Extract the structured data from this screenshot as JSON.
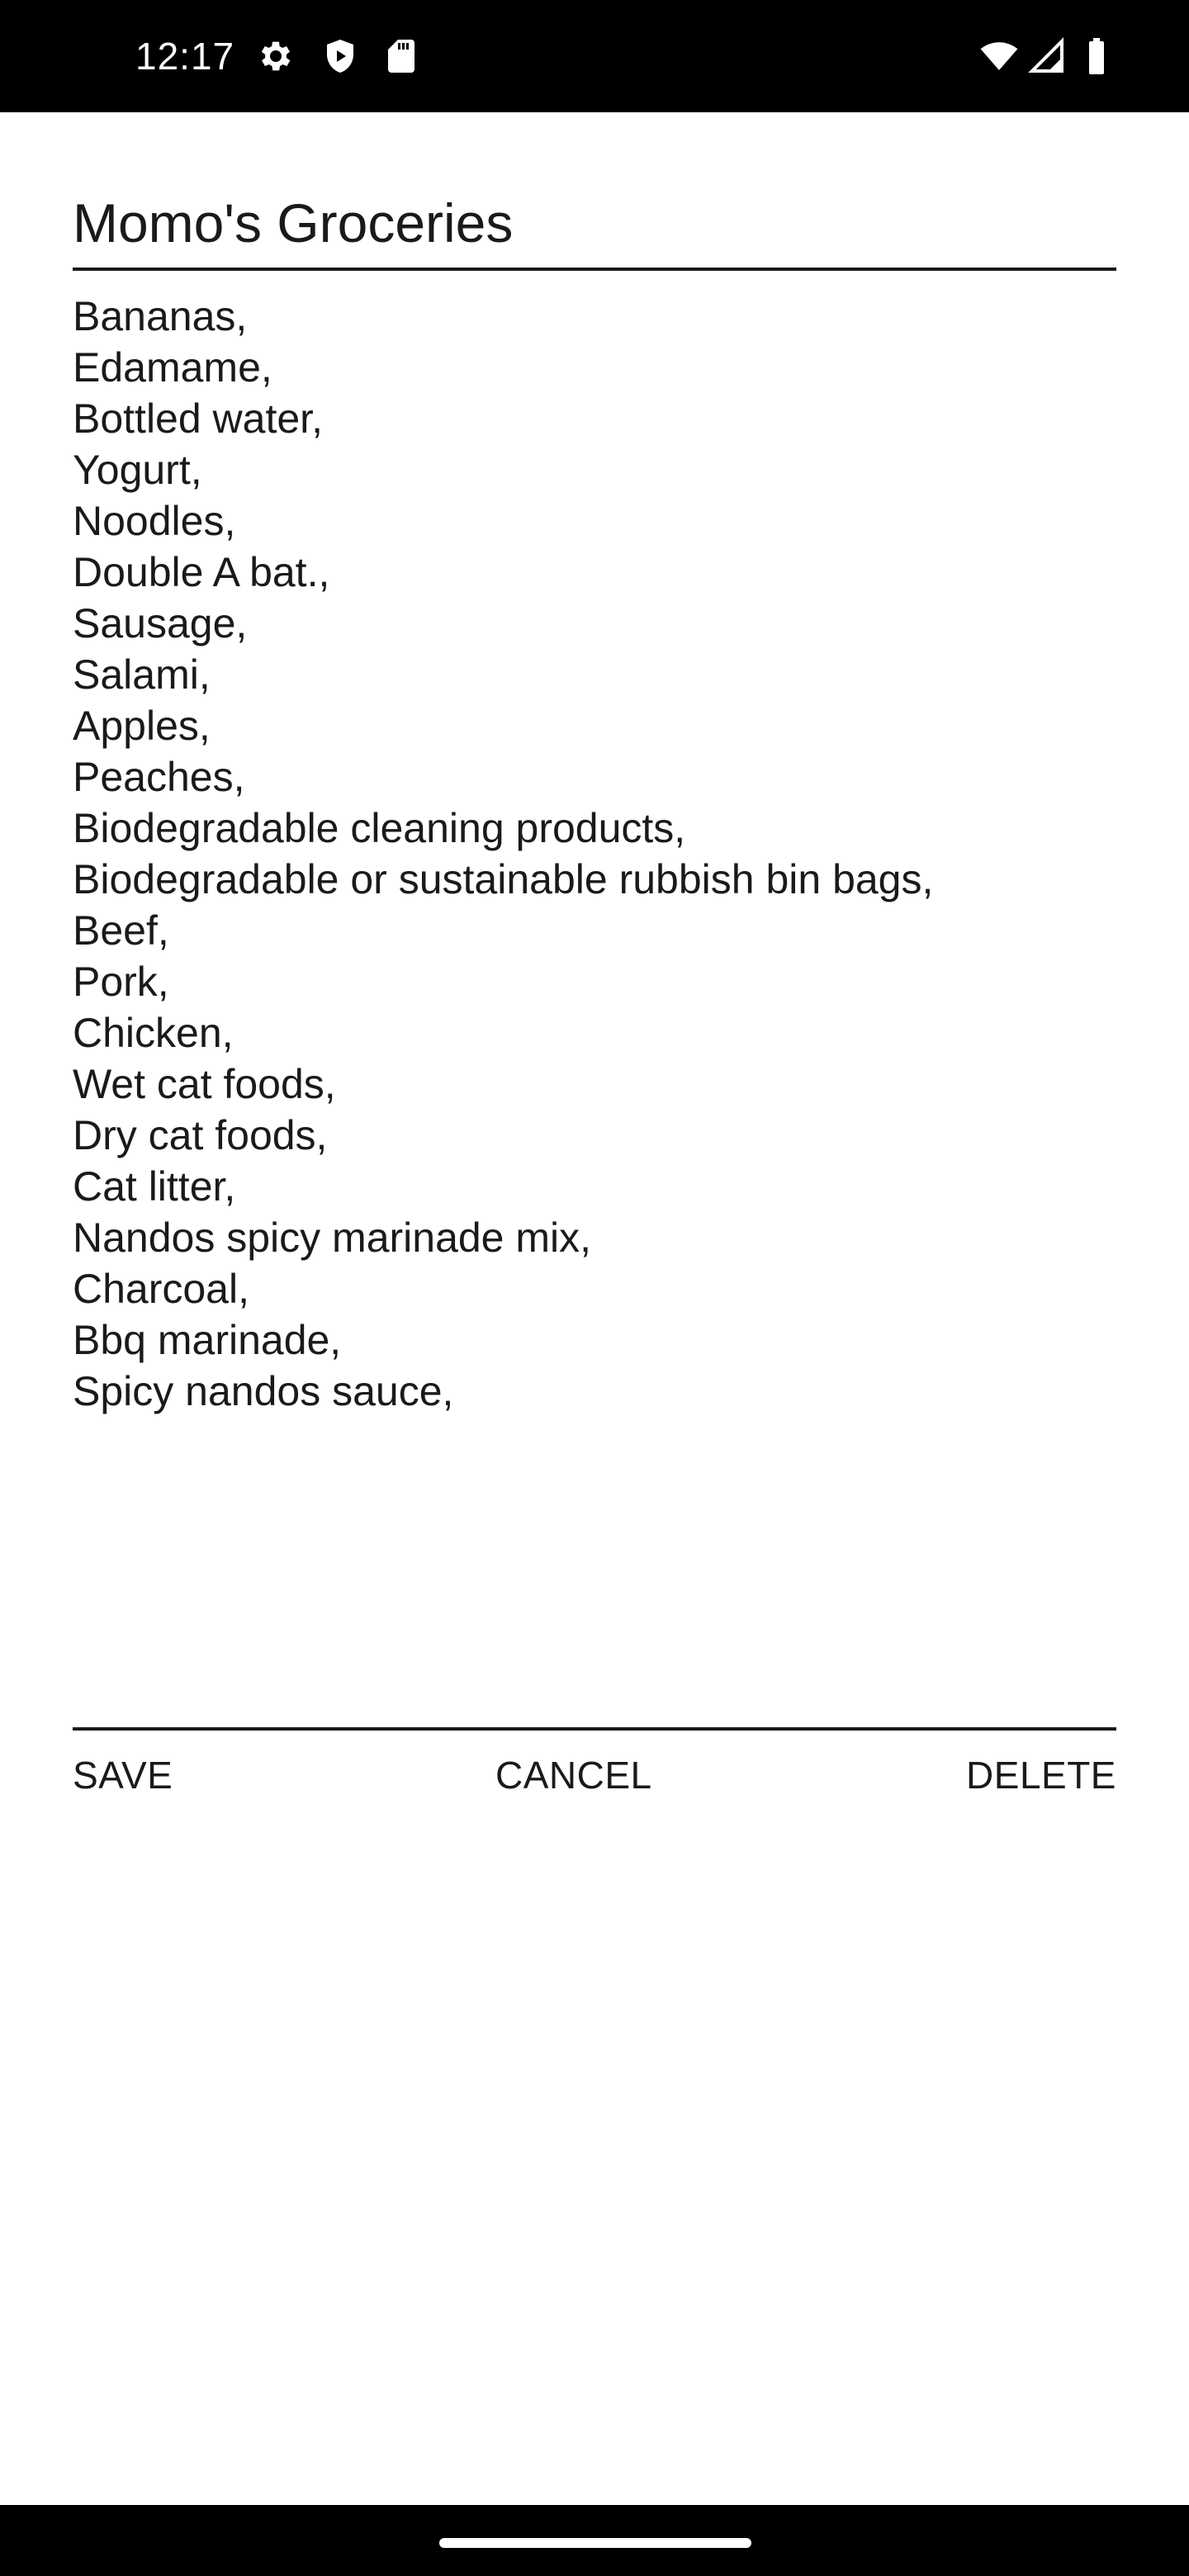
{
  "status_bar": {
    "time": "12:17",
    "left_icons": [
      "gear-icon",
      "shield-icon",
      "sd-card-icon"
    ],
    "right_icons": [
      "wifi-icon",
      "cell-signal-icon",
      "battery-icon"
    ]
  },
  "note": {
    "title": "Momo's Groceries",
    "items": [
      "Bananas,",
      "Edamame,",
      "Bottled water,",
      "Yogurt,",
      "Noodles,",
      "Double A bat.,",
      "Sausage,",
      "Salami,",
      "Apples,",
      "Peaches,",
      "Biodegradable cleaning products,",
      "Biodegradable or sustainable rubbish bin bags,",
      "Beef,",
      "Pork,",
      "Chicken,",
      "Wet cat foods,",
      "Dry cat foods,",
      "Cat litter,",
      "Nandos spicy marinade mix,",
      "Charcoal,",
      "Bbq marinade,",
      "Spicy nandos sauce,"
    ]
  },
  "actions": {
    "save_label": "SAVE",
    "cancel_label": "CANCEL",
    "delete_label": "DELETE"
  },
  "colors": {
    "status_bar_bg": "#000000",
    "background": "#ffffff",
    "text": "#1a1a1a",
    "nav_bar_bg": "#000000"
  }
}
